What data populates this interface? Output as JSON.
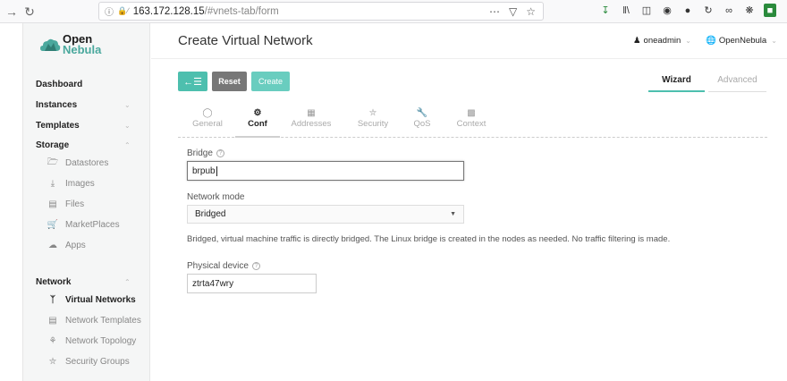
{
  "browser": {
    "url_host": "163.172.128.15",
    "url_path": "/#vnets-tab/form"
  },
  "logo": {
    "line1": "Open",
    "line2": "Nebula"
  },
  "sidebar": {
    "dashboard": "Dashboard",
    "instances": "Instances",
    "templates": "Templates",
    "storage": "Storage",
    "storage_items": [
      "Datastores",
      "Images",
      "Files",
      "MarketPlaces",
      "Apps"
    ],
    "network": "Network",
    "network_items": [
      "Virtual Networks",
      "Network Templates",
      "Network Topology",
      "Security Groups"
    ],
    "active_item": "Virtual Networks"
  },
  "header": {
    "title": "Create Virtual Network",
    "user": "oneadmin",
    "zone": "OpenNebula"
  },
  "actions": {
    "back_icon": "back-list-icon",
    "reset_label": "Reset",
    "create_label": "Create"
  },
  "modes": {
    "wizard": "Wizard",
    "advanced": "Advanced",
    "active": "Wizard"
  },
  "tabs": [
    {
      "label": "General",
      "icon": "globe-icon"
    },
    {
      "label": "Conf",
      "icon": "gear-icon"
    },
    {
      "label": "Addresses",
      "icon": "table-icon"
    },
    {
      "label": "Security",
      "icon": "shield-icon"
    },
    {
      "label": "QoS",
      "icon": "wrench-icon"
    },
    {
      "label": "Context",
      "icon": "folder-icon"
    }
  ],
  "form": {
    "bridge_label": "Bridge",
    "bridge_value": "brpub",
    "network_mode_label": "Network mode",
    "network_mode_value": "Bridged",
    "network_mode_description": "Bridged, virtual machine traffic is directly bridged. The Linux bridge is created in the nodes as needed. No traffic filtering is made.",
    "physical_device_label": "Physical device",
    "physical_device_value": "ztrta47wry"
  },
  "colors": {
    "accent": "#4dbfae",
    "reset": "#777777",
    "create": "#69cdbf"
  }
}
